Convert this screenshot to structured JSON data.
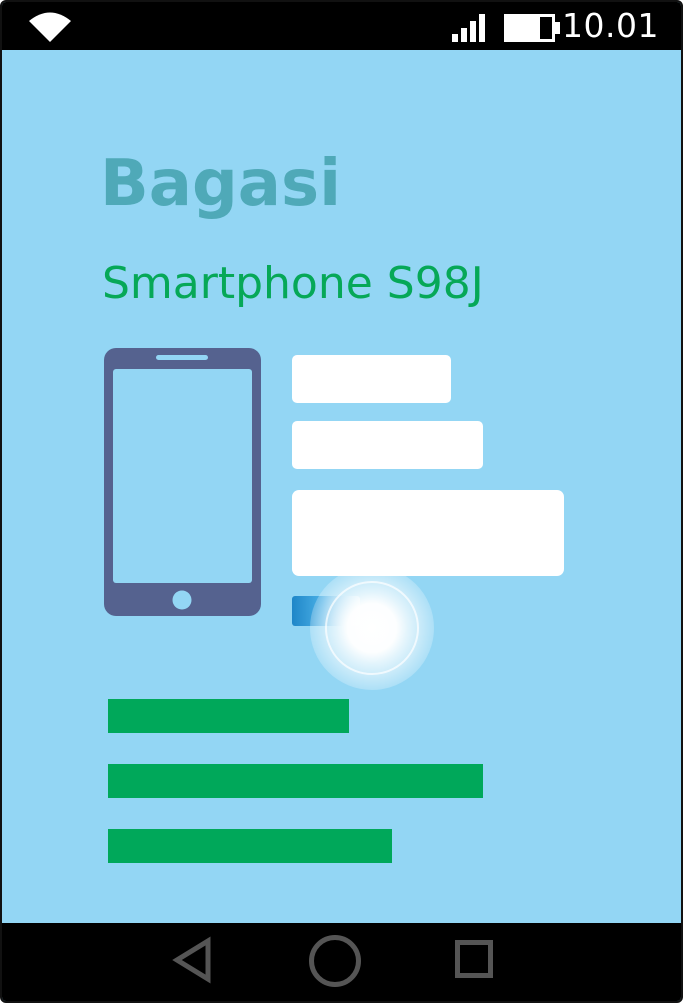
{
  "status_bar": {
    "time": "10.01",
    "icons": [
      "wifi-icon",
      "signal-icon",
      "battery-icon"
    ],
    "battery_level": 0.75
  },
  "app": {
    "title": "Bagasi",
    "product_name": "Smartphone S98J",
    "product_icon": "smartphone-icon"
  },
  "form": {
    "field_count": 3,
    "button_label": ""
  },
  "nav_bar": {
    "icons": [
      "back-icon",
      "home-icon",
      "recent-apps-icon"
    ]
  },
  "colors": {
    "background": "#93d6f4",
    "title": "#4fa9b8",
    "product_name": "#06a857",
    "text_lines": "#00a85a",
    "phone_icon": "#55628f",
    "bars": "#000000"
  }
}
